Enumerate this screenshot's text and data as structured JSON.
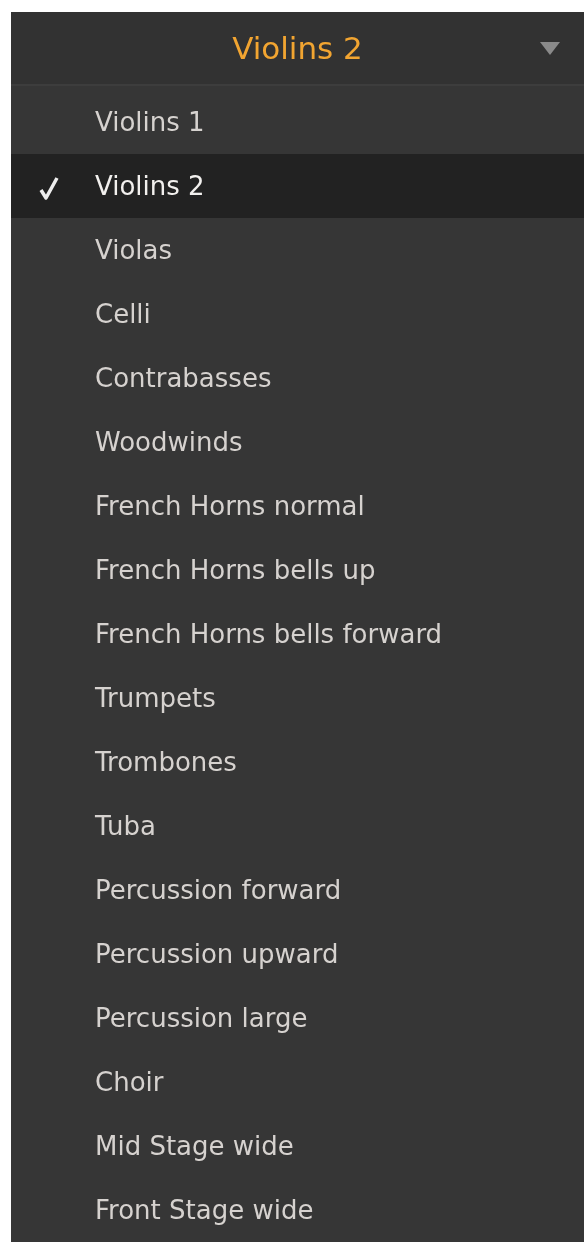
{
  "dropdown": {
    "value": "Violins 2"
  },
  "menu": {
    "items": [
      {
        "label": "Violins 1",
        "selected": false
      },
      {
        "label": "Violins 2",
        "selected": true
      },
      {
        "label": "Violas",
        "selected": false
      },
      {
        "label": "Celli",
        "selected": false
      },
      {
        "label": "Contrabasses",
        "selected": false
      },
      {
        "label": "Woodwinds",
        "selected": false
      },
      {
        "label": "French Horns normal",
        "selected": false
      },
      {
        "label": "French Horns bells up",
        "selected": false
      },
      {
        "label": "French Horns bells forward",
        "selected": false
      },
      {
        "label": "Trumpets",
        "selected": false
      },
      {
        "label": "Trombones",
        "selected": false
      },
      {
        "label": "Tuba",
        "selected": false
      },
      {
        "label": "Percussion forward",
        "selected": false
      },
      {
        "label": "Percussion upward",
        "selected": false
      },
      {
        "label": "Percussion large",
        "selected": false
      },
      {
        "label": "Choir",
        "selected": false
      },
      {
        "label": "Mid Stage wide",
        "selected": false
      },
      {
        "label": "Front Stage wide",
        "selected": false
      }
    ]
  }
}
